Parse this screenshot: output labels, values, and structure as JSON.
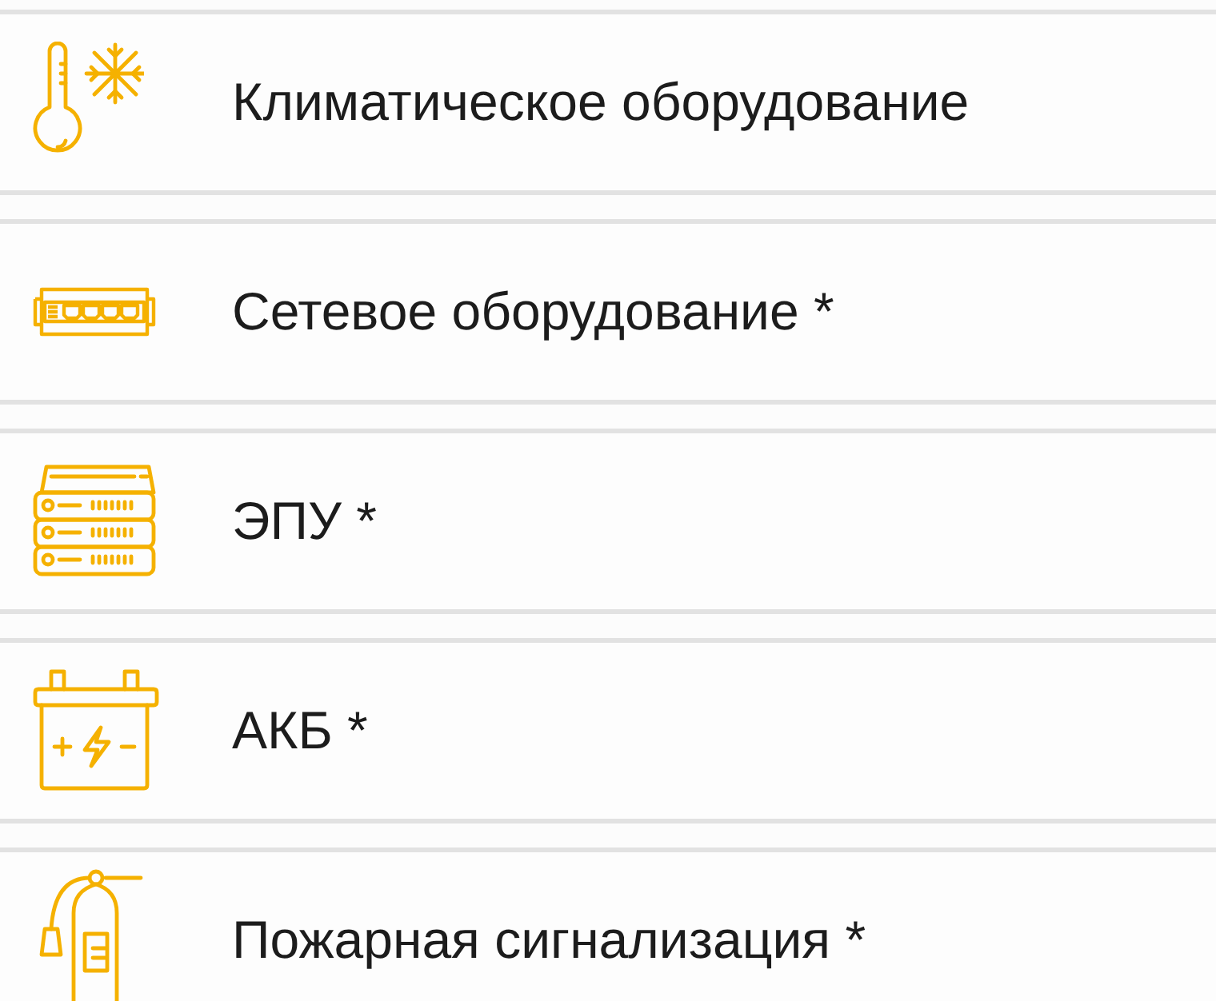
{
  "items": [
    {
      "kind": "climate",
      "label": "Климатическое оборудование"
    },
    {
      "kind": "network",
      "label": "Сетевое оборудование *"
    },
    {
      "kind": "power",
      "label": "ЭПУ *"
    },
    {
      "kind": "battery",
      "label": "АКБ *"
    },
    {
      "kind": "fire",
      "label": "Пожарная сигнализация *"
    }
  ]
}
